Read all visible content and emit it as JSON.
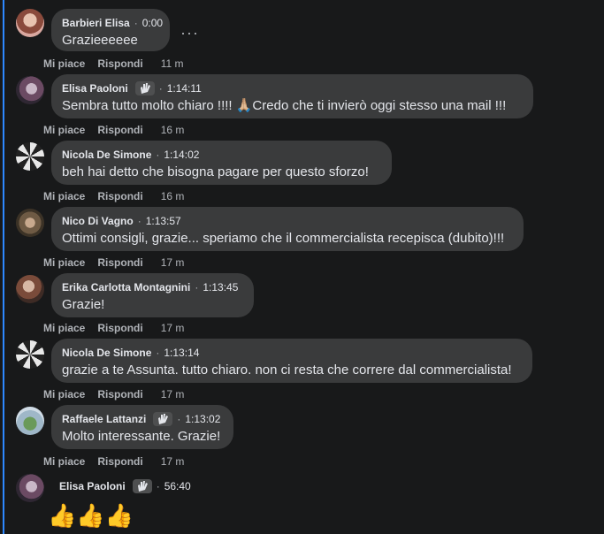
{
  "actions": {
    "like_label": "Mi piace",
    "reply_label": "Rispondi"
  },
  "comments": [
    {
      "author": "Barbieri Elisa",
      "time": "0:00",
      "text": "Grazieeeeee",
      "ago": "11 m",
      "badge": false
    },
    {
      "author": "Elisa Paoloni",
      "time": "1:14:11",
      "text": "Sembra tutto molto chiaro !!!! 🙏🏼Credo che ti invierò oggi stesso una mail !!!",
      "ago": "16 m",
      "badge": true
    },
    {
      "author": "Nicola De Simone",
      "time": "1:14:02",
      "text": "beh hai detto che bisogna pagare per questo sforzo!",
      "ago": "16 m",
      "badge": false
    },
    {
      "author": "Nico Di Vagno",
      "time": "1:13:57",
      "text": "Ottimi consigli, grazie... speriamo che il commercialista recepisca (dubito)!!!",
      "ago": "17 m",
      "badge": false
    },
    {
      "author": "Erika Carlotta Montagnini",
      "time": "1:13:45",
      "text": "Grazie!",
      "ago": "17 m",
      "badge": false
    },
    {
      "author": "Nicola De Simone",
      "time": "1:13:14",
      "text": "grazie a te Assunta. tutto chiaro. non ci resta che correre dal commercialista!",
      "ago": "17 m",
      "badge": false
    },
    {
      "author": "Raffaele Lattanzi",
      "time": "1:13:02",
      "text": "Molto interessante. Grazie!",
      "ago": "17 m",
      "badge": true
    },
    {
      "author": "Elisa Paoloni",
      "time": "56:40",
      "text": "👍👍👍",
      "ago": "",
      "badge": true
    }
  ],
  "more_glyph": "···",
  "colors": {
    "background": "#18191a",
    "bubble": "#3a3b3c",
    "muted_text": "#b0b3b8",
    "accent_line": "#2d88ff"
  }
}
